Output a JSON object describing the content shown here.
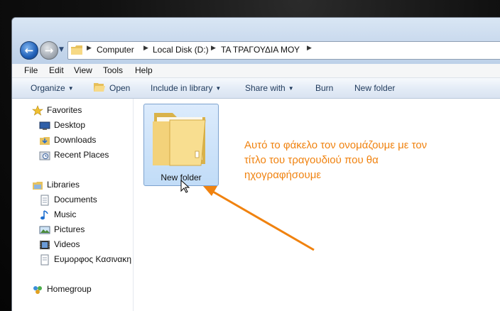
{
  "address": {
    "crumbs": [
      "Computer",
      "Local Disk (D:)",
      "ΤΑ ΤΡΑΓΟΥΔΙΑ ΜΟΥ"
    ]
  },
  "menu": [
    "File",
    "Edit",
    "View",
    "Tools",
    "Help"
  ],
  "toolbar": {
    "organize": "Organize",
    "open": "Open",
    "include": "Include in library",
    "share": "Share with",
    "burn": "Burn",
    "new_folder": "New folder"
  },
  "nav": {
    "favorites": {
      "label": "Favorites",
      "items": [
        "Desktop",
        "Downloads",
        "Recent Places"
      ]
    },
    "libraries": {
      "label": "Libraries",
      "items": [
        "Documents",
        "Music",
        "Pictures",
        "Videos",
        "Ευμορφος Κασινακη"
      ]
    },
    "homegroup": "Homegroup"
  },
  "content": {
    "folder_name": "New folder"
  },
  "annotation": {
    "lines": [
      "Αυτό το φάκελο τον ονομάζουμε με τον",
      "τίτλο του τραγουδιού που θα",
      "ηχογραφήσουμε"
    ]
  },
  "colors": {
    "annotation": "#f0820f",
    "accent": "#1e395b",
    "selection": "#c1dcf7"
  }
}
